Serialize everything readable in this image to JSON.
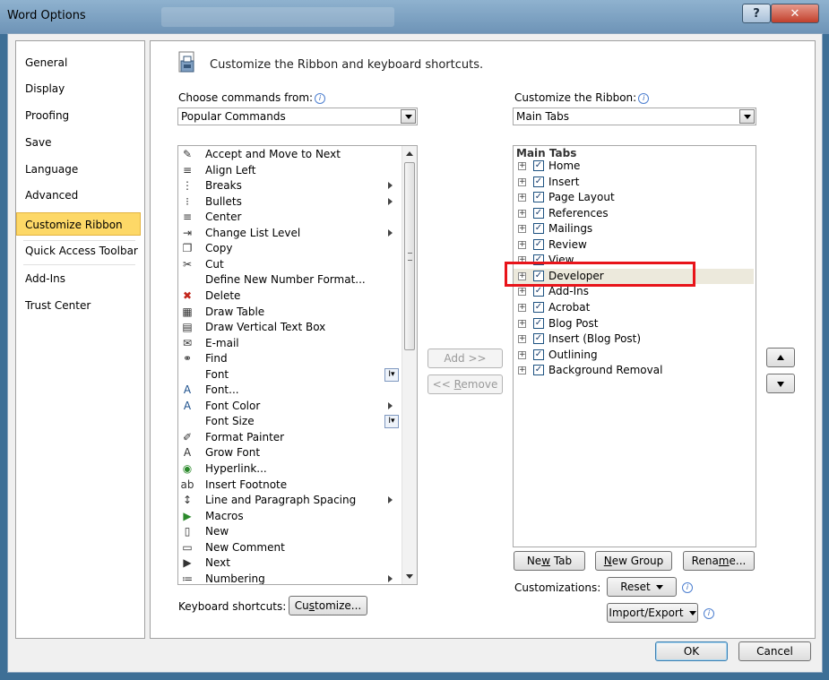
{
  "window": {
    "title": "Word Options"
  },
  "nav": {
    "items": [
      "General",
      "Display",
      "Proofing",
      "Save",
      "Language",
      "Advanced",
      "Customize Ribbon",
      "Quick Access Toolbar",
      "Add-Ins",
      "Trust Center"
    ],
    "selected": "Customize Ribbon"
  },
  "header": {
    "text": "Customize the Ribbon and keyboard shortcuts."
  },
  "left": {
    "label": "Choose commands from:",
    "combo_value": "Popular Commands",
    "commands": [
      {
        "label": "Accept and Move to Next",
        "icon": "accept-icon"
      },
      {
        "label": "Align Left",
        "icon": "align-left-icon"
      },
      {
        "label": "Breaks",
        "icon": "breaks-icon"
      },
      {
        "label": "Bullets",
        "icon": "bullets-icon"
      },
      {
        "label": "Center",
        "icon": "center-icon"
      },
      {
        "label": "Change List Level",
        "icon": "list-level-icon"
      },
      {
        "label": "Copy",
        "icon": "copy-icon"
      },
      {
        "label": "Cut",
        "icon": "scissors-icon"
      },
      {
        "label": "Define New Number Format...",
        "icon": ""
      },
      {
        "label": "Delete",
        "icon": "delete-icon"
      },
      {
        "label": "Draw Table",
        "icon": "draw-table-icon"
      },
      {
        "label": "Draw Vertical Text Box",
        "icon": "text-box-icon"
      },
      {
        "label": "E-mail",
        "icon": "email-icon"
      },
      {
        "label": "Find",
        "icon": "binoculars-icon"
      },
      {
        "label": "Font",
        "icon": ""
      },
      {
        "label": "Font...",
        "icon": "font-icon"
      },
      {
        "label": "Font Color",
        "icon": "font-color-icon"
      },
      {
        "label": "Font Size",
        "icon": ""
      },
      {
        "label": "Format Painter",
        "icon": "brush-icon"
      },
      {
        "label": "Grow Font",
        "icon": "grow-font-icon"
      },
      {
        "label": "Hyperlink...",
        "icon": "globe-icon"
      },
      {
        "label": "Insert Footnote",
        "icon": "footnote-icon"
      },
      {
        "label": "Line and Paragraph Spacing",
        "icon": "line-spacing-icon"
      },
      {
        "label": "Macros",
        "icon": "play-icon"
      },
      {
        "label": "New",
        "icon": "new-doc-icon"
      },
      {
        "label": "New Comment",
        "icon": "comment-icon"
      },
      {
        "label": "Next",
        "icon": "next-icon"
      },
      {
        "label": "Numbering",
        "icon": "numbering-icon"
      }
    ]
  },
  "right": {
    "label": "Customize the Ribbon:",
    "combo_value": "Main Tabs",
    "tree_header": "Main Tabs",
    "tabs": [
      "Home",
      "Insert",
      "Page Layout",
      "References",
      "Mailings",
      "Review",
      "View",
      "Developer",
      "Add-Ins",
      "Acrobat",
      "Blog Post",
      "Insert (Blog Post)",
      "Outlining",
      "Background Removal"
    ],
    "selected": "Developer"
  },
  "buttons": {
    "add": "Add >>",
    "remove": "<< Remove",
    "new_tab": "New Tab",
    "new_group": "New Group",
    "rename": "Rename...",
    "reset": "Reset",
    "import_export": "Import/Export",
    "customize": "Customize...",
    "ok": "OK",
    "cancel": "Cancel"
  },
  "labels": {
    "customizations": "Customizations:",
    "keyboard_shortcuts": "Keyboard shortcuts:"
  },
  "colors": {
    "nav_selected": "#fdd867",
    "highlight_border": "#e8141a",
    "title_bar": "#6d93b6"
  }
}
